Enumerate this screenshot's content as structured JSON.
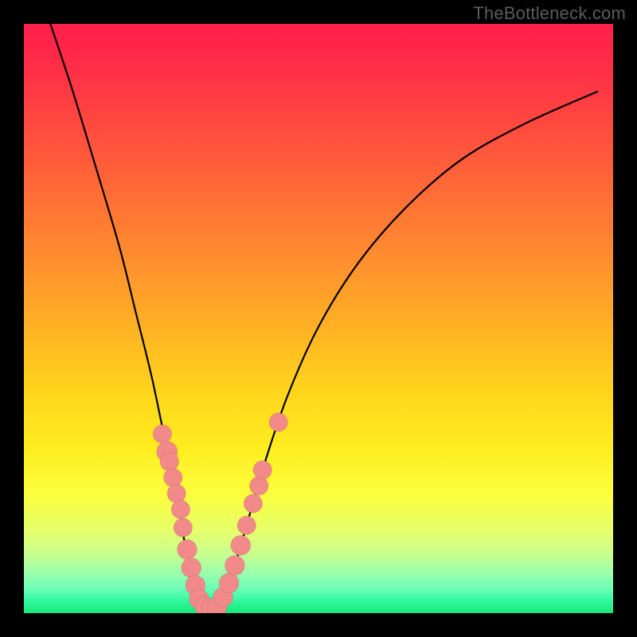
{
  "watermark": "TheBottleneck.com",
  "colors": {
    "page_bg": "#000000",
    "curve_stroke": "#000000",
    "marker_fill": "#f28a8a",
    "gradient_top": "#ff1f4b",
    "gradient_bottom": "#18e879"
  },
  "chart_data": {
    "type": "line",
    "title": "",
    "xlabel": "",
    "ylabel": "",
    "xlim": [
      0,
      100
    ],
    "ylim": [
      0,
      100
    ],
    "grid": false,
    "legend": false,
    "note": "V-shaped bottleneck curve over vertical red→green gradient. Axis values are estimated from pixel positions (no tick labels visible).",
    "curve_points": [
      {
        "x": 4.5,
        "y": 100.0
      },
      {
        "x": 8.1,
        "y": 89.2
      },
      {
        "x": 12.2,
        "y": 75.7
      },
      {
        "x": 16.2,
        "y": 62.2
      },
      {
        "x": 18.9,
        "y": 51.4
      },
      {
        "x": 21.6,
        "y": 40.5
      },
      {
        "x": 23.6,
        "y": 31.1
      },
      {
        "x": 25.7,
        "y": 21.6
      },
      {
        "x": 27.0,
        "y": 13.5
      },
      {
        "x": 28.4,
        "y": 6.8
      },
      {
        "x": 29.7,
        "y": 2.7
      },
      {
        "x": 31.1,
        "y": 0.7
      },
      {
        "x": 32.4,
        "y": 0.7
      },
      {
        "x": 33.8,
        "y": 2.7
      },
      {
        "x": 35.8,
        "y": 8.1
      },
      {
        "x": 37.8,
        "y": 14.9
      },
      {
        "x": 40.5,
        "y": 24.3
      },
      {
        "x": 44.6,
        "y": 36.5
      },
      {
        "x": 50.0,
        "y": 48.6
      },
      {
        "x": 56.8,
        "y": 59.5
      },
      {
        "x": 64.9,
        "y": 68.9
      },
      {
        "x": 74.3,
        "y": 77.0
      },
      {
        "x": 85.1,
        "y": 83.1
      },
      {
        "x": 97.3,
        "y": 88.5
      }
    ],
    "markers": [
      {
        "x": 23.5,
        "y": 30.4,
        "r": 1.1
      },
      {
        "x": 24.3,
        "y": 27.4,
        "r": 1.3
      },
      {
        "x": 24.7,
        "y": 25.7,
        "r": 1.1
      },
      {
        "x": 25.3,
        "y": 23.0,
        "r": 1.1
      },
      {
        "x": 25.9,
        "y": 20.3,
        "r": 1.1
      },
      {
        "x": 26.6,
        "y": 17.6,
        "r": 1.1
      },
      {
        "x": 27.0,
        "y": 14.5,
        "r": 1.1
      },
      {
        "x": 27.7,
        "y": 10.8,
        "r": 1.2
      },
      {
        "x": 28.4,
        "y": 7.7,
        "r": 1.2
      },
      {
        "x": 29.1,
        "y": 4.7,
        "r": 1.2
      },
      {
        "x": 29.7,
        "y": 2.4,
        "r": 1.2
      },
      {
        "x": 30.7,
        "y": 1.1,
        "r": 1.2
      },
      {
        "x": 31.8,
        "y": 0.7,
        "r": 1.2
      },
      {
        "x": 32.8,
        "y": 1.1,
        "r": 1.2
      },
      {
        "x": 33.8,
        "y": 2.7,
        "r": 1.2
      },
      {
        "x": 34.8,
        "y": 5.1,
        "r": 1.2
      },
      {
        "x": 35.8,
        "y": 8.1,
        "r": 1.2
      },
      {
        "x": 36.8,
        "y": 11.5,
        "r": 1.2
      },
      {
        "x": 37.8,
        "y": 14.9,
        "r": 1.1
      },
      {
        "x": 38.9,
        "y": 18.6,
        "r": 1.1
      },
      {
        "x": 39.9,
        "y": 21.6,
        "r": 1.1
      },
      {
        "x": 40.5,
        "y": 24.3,
        "r": 1.1
      },
      {
        "x": 43.2,
        "y": 32.4,
        "r": 1.1
      }
    ]
  }
}
